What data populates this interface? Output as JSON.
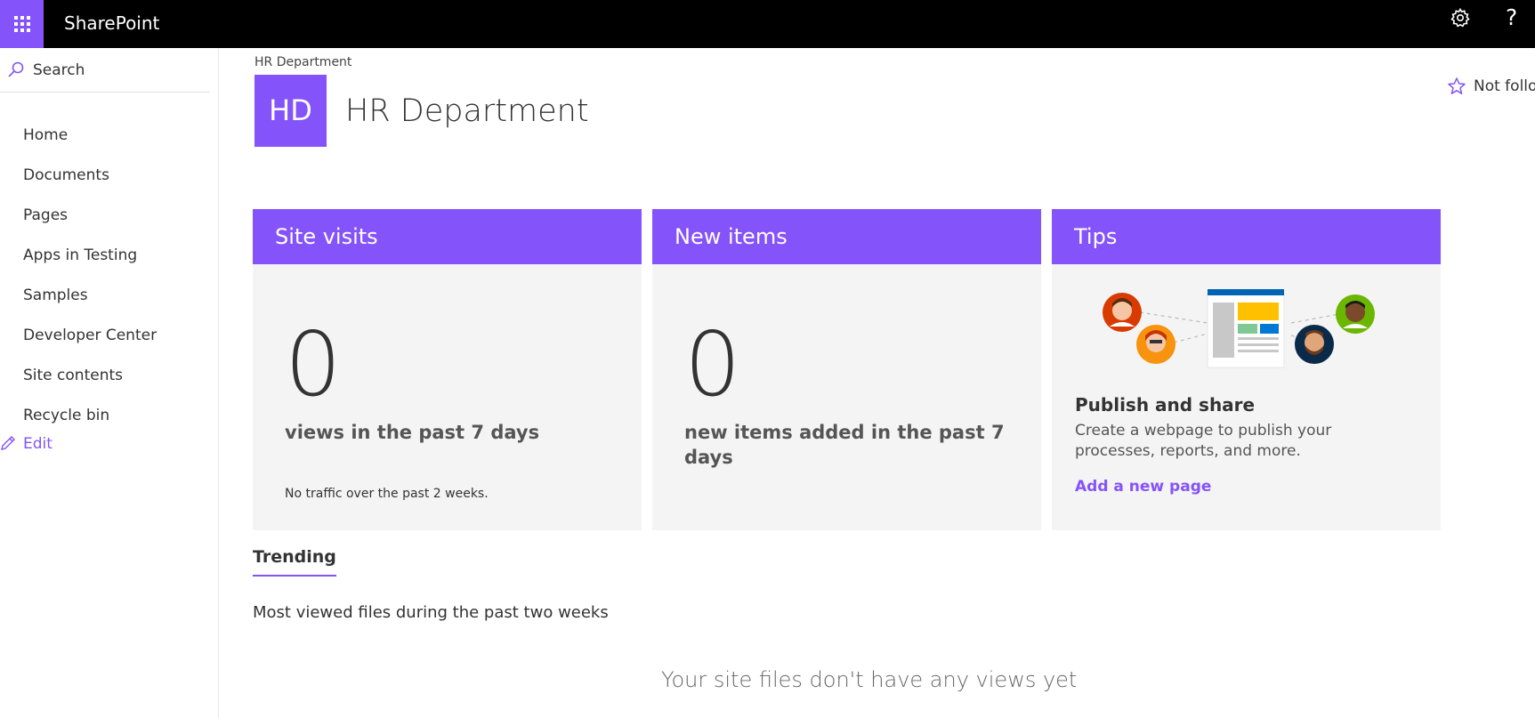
{
  "suite_bar": {
    "app_name": "SharePoint",
    "icons": [
      "waffle-icon",
      "gear-icon",
      "help-icon"
    ],
    "help_glyph": "?"
  },
  "left_nav": {
    "search_label": "Search",
    "items": [
      {
        "label": "Home"
      },
      {
        "label": "Documents"
      },
      {
        "label": "Pages"
      },
      {
        "label": "Apps in Testing"
      },
      {
        "label": "Samples"
      },
      {
        "label": "Developer Center"
      },
      {
        "label": "Site contents"
      },
      {
        "label": "Recycle bin"
      }
    ],
    "edit_label": "Edit"
  },
  "site": {
    "breadcrumb": "HR Department",
    "logo_initials": "HD",
    "title": "HR Department",
    "follow_label": "Not following"
  },
  "cards": {
    "site_visits": {
      "title": "Site visits",
      "value": "0",
      "caption": "views in the past 7 days",
      "note": "No traffic over the past 2 weeks."
    },
    "new_items": {
      "title": "New items",
      "value": "0",
      "caption": "new items added in the past 7 days"
    },
    "tips": {
      "title": "Tips",
      "heading": "Publish and share",
      "body": "Create a webpage to publish your processes, reports, and more.",
      "link": "Add a new page"
    }
  },
  "trending": {
    "tab_label": "Trending",
    "description": "Most viewed files during the past two weeks",
    "empty_message": "Your site files don't have any views yet"
  },
  "colors": {
    "accent": "#8553fa",
    "suite_bar": "#000000",
    "card_bg": "#f4f4f4"
  }
}
